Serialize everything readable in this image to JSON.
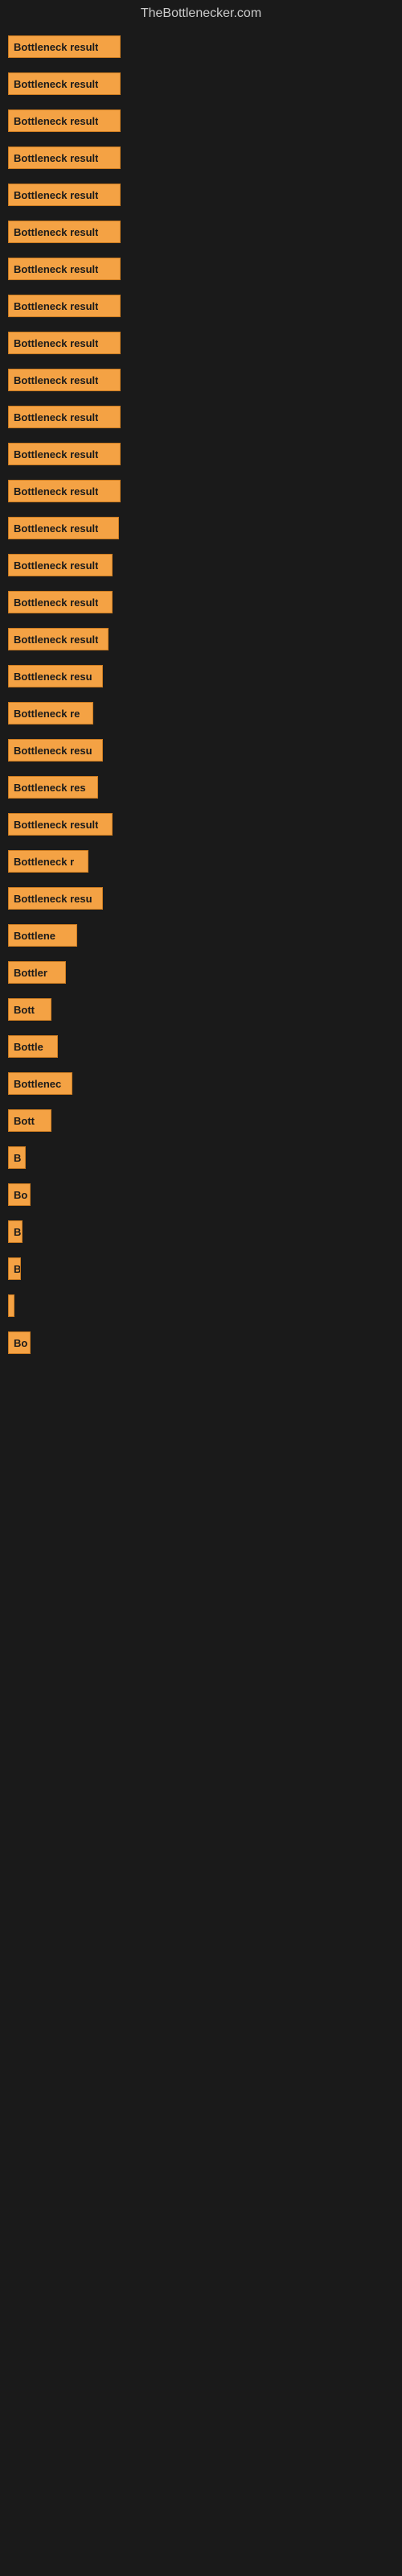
{
  "site": {
    "title": "TheBottlenecker.com"
  },
  "bars": [
    {
      "label": "Bottleneck result",
      "width": 140,
      "spacer": true
    },
    {
      "label": "Bottleneck result",
      "width": 140,
      "spacer": true
    },
    {
      "label": "Bottleneck result",
      "width": 140,
      "spacer": true
    },
    {
      "label": "Bottleneck result",
      "width": 140,
      "spacer": true
    },
    {
      "label": "Bottleneck result",
      "width": 140,
      "spacer": true
    },
    {
      "label": "Bottleneck result",
      "width": 140,
      "spacer": true
    },
    {
      "label": "Bottleneck result",
      "width": 140,
      "spacer": true
    },
    {
      "label": "Bottleneck result",
      "width": 140,
      "spacer": true
    },
    {
      "label": "Bottleneck result",
      "width": 140,
      "spacer": true
    },
    {
      "label": "Bottleneck result",
      "width": 140,
      "spacer": true
    },
    {
      "label": "Bottleneck result",
      "width": 140,
      "spacer": true
    },
    {
      "label": "Bottleneck result",
      "width": 140,
      "spacer": true
    },
    {
      "label": "Bottleneck result",
      "width": 140,
      "spacer": true
    },
    {
      "label": "Bottleneck result",
      "width": 138,
      "spacer": true
    },
    {
      "label": "Bottleneck result",
      "width": 130,
      "spacer": true
    },
    {
      "label": "Bottleneck result",
      "width": 130,
      "spacer": true
    },
    {
      "label": "Bottleneck result",
      "width": 125,
      "spacer": true
    },
    {
      "label": "Bottleneck resu",
      "width": 118,
      "spacer": true
    },
    {
      "label": "Bottleneck re",
      "width": 106,
      "spacer": true
    },
    {
      "label": "Bottleneck resu",
      "width": 118,
      "spacer": true
    },
    {
      "label": "Bottleneck res",
      "width": 112,
      "spacer": true
    },
    {
      "label": "Bottleneck result",
      "width": 130,
      "spacer": true
    },
    {
      "label": "Bottleneck r",
      "width": 100,
      "spacer": true
    },
    {
      "label": "Bottleneck resu",
      "width": 118,
      "spacer": true
    },
    {
      "label": "Bottlene",
      "width": 86,
      "spacer": true
    },
    {
      "label": "Bottler",
      "width": 72,
      "spacer": true
    },
    {
      "label": "Bott",
      "width": 54,
      "spacer": true
    },
    {
      "label": "Bottle",
      "width": 62,
      "spacer": true
    },
    {
      "label": "Bottlenec",
      "width": 80,
      "spacer": true
    },
    {
      "label": "Bott",
      "width": 54,
      "spacer": true
    },
    {
      "label": "B",
      "width": 22,
      "spacer": true
    },
    {
      "label": "Bo",
      "width": 28,
      "spacer": true
    },
    {
      "label": "B",
      "width": 18,
      "spacer": true
    },
    {
      "label": "B",
      "width": 16,
      "spacer": true
    },
    {
      "label": "",
      "width": 8,
      "spacer": true
    },
    {
      "label": "Bo",
      "width": 28,
      "spacer": false
    }
  ]
}
